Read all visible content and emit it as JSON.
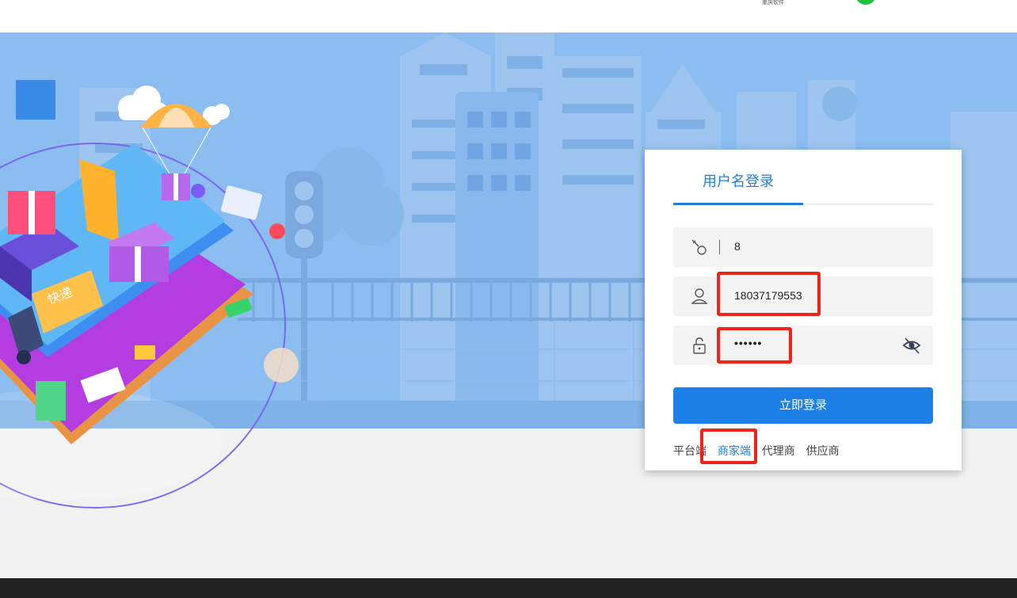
{
  "header": {
    "brand_subtext": "重庆软件"
  },
  "login": {
    "tab_label": "用户名登录",
    "code_value": "8",
    "username_value": "18037179553",
    "password_value": "••••••",
    "submit_label": "立即登录",
    "roles": [
      {
        "label": "平台端",
        "active": false
      },
      {
        "label": "商家端",
        "active": true
      },
      {
        "label": "代理商",
        "active": false
      },
      {
        "label": "供应商",
        "active": false
      }
    ]
  },
  "illustration": {
    "truck_label": "快递"
  },
  "colors": {
    "accent": "#1f7fd8",
    "button": "#1c80e6",
    "highlight": "#f0231a",
    "hero_bg": "#8bbdf0"
  }
}
